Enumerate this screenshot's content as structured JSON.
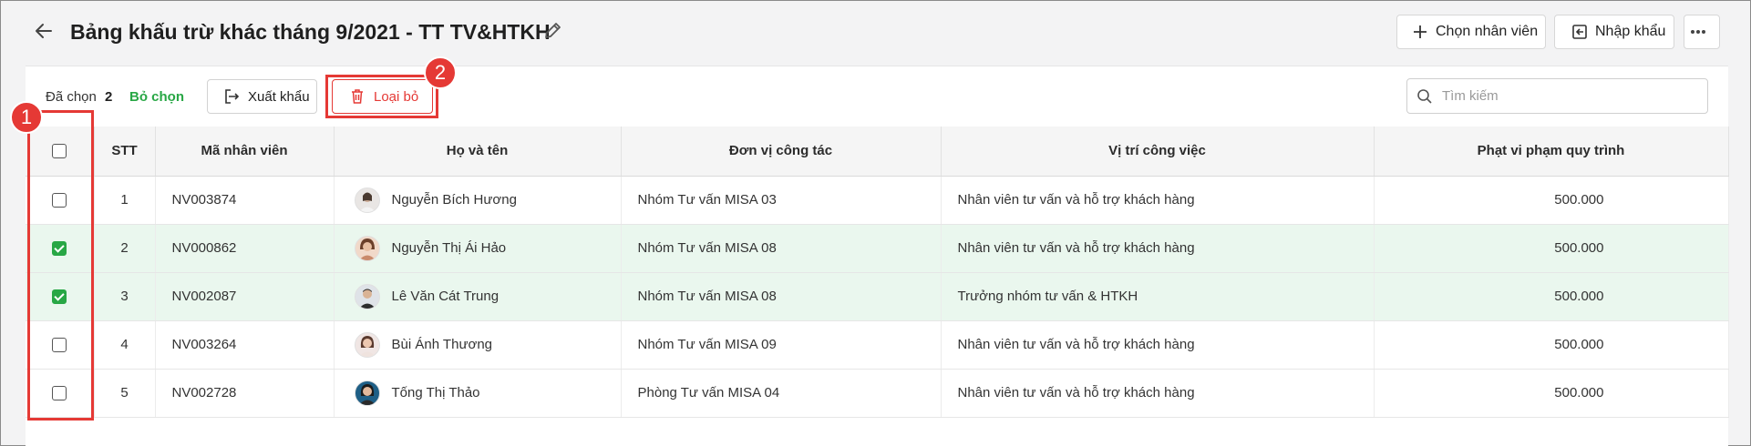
{
  "header": {
    "title": "Bảng khấu trừ khác tháng 9/2021 - TT TV&HTKH",
    "choose_employee_label": "Chọn nhân viên",
    "import_label": "Nhập khẩu"
  },
  "toolbar": {
    "selected_label": "Đã chọn",
    "selected_count": "2",
    "unselect_label": "Bỏ chọn",
    "export_label": "Xuất khẩu",
    "remove_label": "Loại bỏ",
    "search_placeholder": "Tìm kiếm"
  },
  "table": {
    "columns": [
      "STT",
      "Mã nhân viên",
      "Họ và tên",
      "Đơn vị công tác",
      "Vị trí công việc",
      "Phạt vi phạm quy trình"
    ],
    "rows": [
      {
        "stt": "1",
        "code": "NV003874",
        "name": "Nguyễn Bích Hương",
        "unit": "Nhóm Tư vấn MISA 03",
        "position": "Nhân viên tư vấn và hỗ trợ khách hàng",
        "fine": "500.000",
        "checked": false
      },
      {
        "stt": "2",
        "code": "NV000862",
        "name": "Nguyễn Thị Ái Hảo",
        "unit": "Nhóm Tư vấn MISA 08",
        "position": "Nhân viên tư vấn và hỗ trợ khách hàng",
        "fine": "500.000",
        "checked": true
      },
      {
        "stt": "3",
        "code": "NV002087",
        "name": "Lê Văn Cát Trung",
        "unit": "Nhóm Tư vấn MISA 08",
        "position": "Trưởng nhóm tư vấn & HTKH",
        "fine": "500.000",
        "checked": true
      },
      {
        "stt": "4",
        "code": "NV003264",
        "name": "Bùi Ánh Thương",
        "unit": "Nhóm Tư vấn MISA 09",
        "position": "Nhân viên tư vấn và hỗ trợ khách hàng",
        "fine": "500.000",
        "checked": false
      },
      {
        "stt": "5",
        "code": "NV002728",
        "name": "Tống Thị Thảo",
        "unit": "Phòng Tư vấn MISA 04",
        "position": "Nhân viên tư vấn và hỗ trợ khách hàng",
        "fine": "500.000",
        "checked": false
      }
    ]
  },
  "annotations": {
    "marker_1": "1",
    "marker_2": "2"
  },
  "colors": {
    "accent_green": "#28a745",
    "danger_red": "#e53935",
    "selected_row_bg": "#eaf7ee"
  }
}
